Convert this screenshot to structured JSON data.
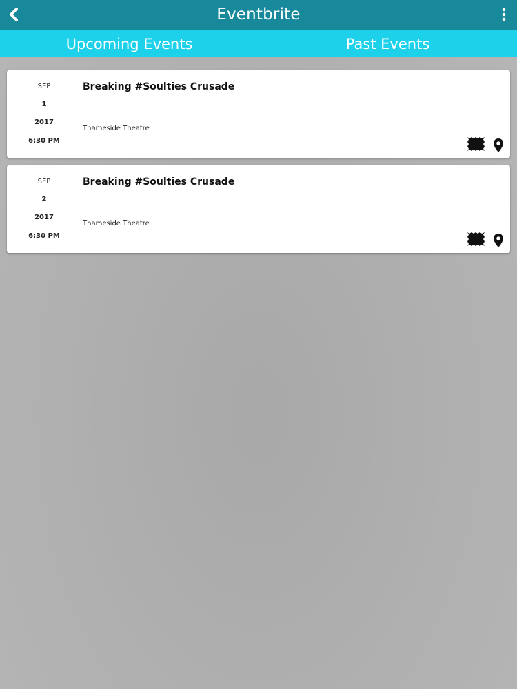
{
  "header": {
    "title": "Eventbrite",
    "back_icon": "chevron-left-icon",
    "menu_icon": "more-vertical-icon",
    "background_color": "#17899a"
  },
  "tabs": {
    "items": [
      {
        "label": "Upcoming Events"
      },
      {
        "label": "Past Events"
      }
    ],
    "background_color": "#1dd1ea"
  },
  "events": [
    {
      "month": "SEP",
      "day": "1",
      "year": "2017",
      "time": "6:30 PM",
      "title": "Breaking #Soulties Crusade",
      "venue": "Thameside Theatre",
      "icons": [
        "ticket-icon",
        "map-pin-icon"
      ]
    },
    {
      "month": "SEP",
      "day": "2",
      "year": "2017",
      "time": "6:30 PM",
      "title": "Breaking #Soulties Crusade",
      "venue": "Thameside Theatre",
      "icons": [
        "ticket-icon",
        "map-pin-icon"
      ]
    }
  ],
  "accent_color": "#35b8d6"
}
